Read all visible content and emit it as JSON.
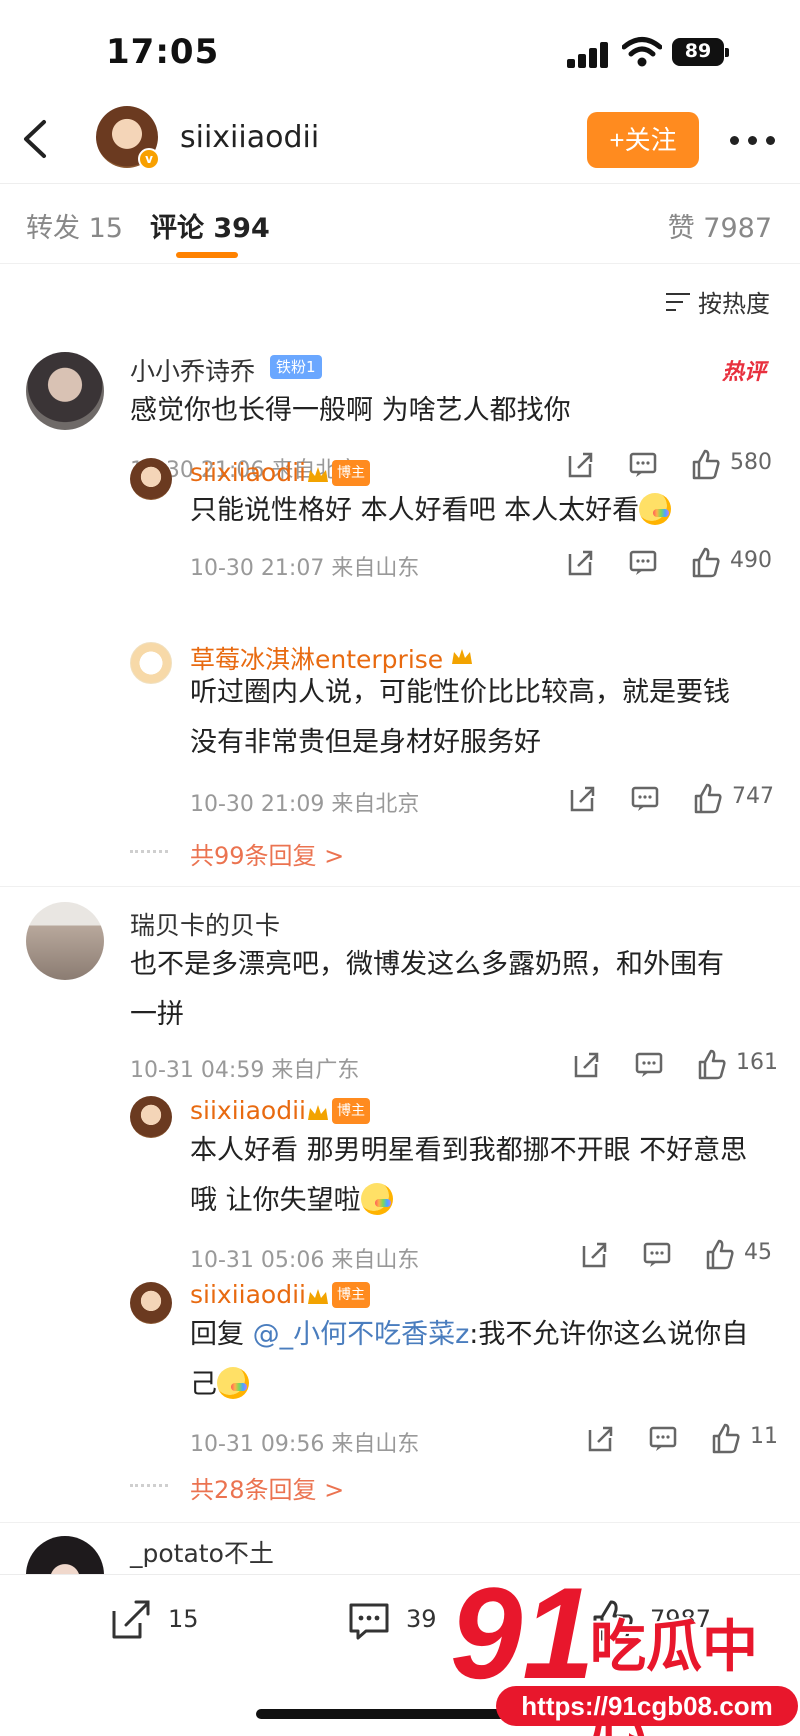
{
  "status_bar": {
    "time": "17:05",
    "battery": "89"
  },
  "header": {
    "username": "siixiiaodii",
    "follow_label": "+关注"
  },
  "tabs": {
    "repost": "转发 15",
    "comments": "评论 394",
    "likes": "赞 7987"
  },
  "sort_label": "按热度",
  "comments": [
    {
      "name": "小小乔诗乔",
      "fan_badge": "铁粉1",
      "hot_badge": "热评",
      "text": "感觉你也长得一般啊 为啥艺人都找你",
      "meta": "10-30 21:06 来自北京",
      "likes": "580",
      "replies": [
        {
          "name": "siixiiaodii",
          "badge": "博主",
          "text": "只能说性格好 本人好看吧 本人太好看",
          "meta": "10-30 21:07 来自山东",
          "likes": "490"
        },
        {
          "name": "草莓冰淇淋enterprise",
          "text_1": "听过圈内人说，可能性价比比较高，就是要钱",
          "text_2": "没有非常贵但是身材好服务好",
          "meta": "10-30 21:09 来自北京",
          "likes": "747"
        }
      ],
      "more_replies": "共99条回复 >"
    },
    {
      "name": "瑞贝卡的贝卡",
      "text_1": "也不是多漂亮吧，微博发这么多露奶照，和外围有",
      "text_2": "一拼",
      "meta": "10-31 04:59 来自广东",
      "likes": "161",
      "replies": [
        {
          "name": "siixiiaodii",
          "badge": "博主",
          "text_1": "本人好看 那男明星看到我都挪不开眼 不好意思",
          "text_2": "哦 让你失望啦",
          "meta": "10-31 05:06 来自山东",
          "likes": "45"
        },
        {
          "name": "siixiiaodii",
          "badge": "博主",
          "reply_prefix": "回复",
          "mention": "@_小何不吃香菜z",
          "text_1": ":我不允许你这么说你自",
          "text_2": "己",
          "meta": "10-31 09:56 来自山东",
          "likes": "11"
        }
      ],
      "more_replies": "共28条回复 >"
    },
    {
      "name": "_potato不土"
    }
  ],
  "bottom_bar": {
    "repost_count": "15",
    "comment_count": "39",
    "like_count": "7987"
  },
  "watermark": {
    "logo_num": "91",
    "logo_text": "吃瓜中心",
    "url": "https://91cgb08.com"
  },
  "colors": {
    "accent": "#ff8200",
    "follow_button": "#ff8b1f",
    "link": "#eb7350",
    "mention": "#4a7dbe",
    "watermark": "#e8172c"
  }
}
